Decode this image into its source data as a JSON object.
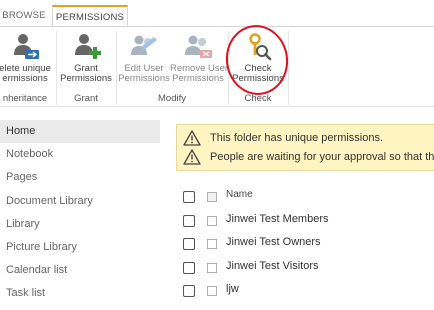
{
  "ribbon": {
    "tabs": [
      {
        "label": "BROWSE"
      },
      {
        "label": "PERMISSIONS"
      }
    ],
    "buttons": {
      "delete_unique": {
        "line1": "elete unique",
        "line2": "ermissions",
        "icon": "users-delete-icon"
      },
      "grant": {
        "line1": "Grant",
        "line2": "Permissions",
        "icon": "user-add-icon"
      },
      "edit_user": {
        "line1": "Edit User",
        "line2": "Permissions",
        "icon": "users-edit-icon"
      },
      "remove_user": {
        "line1": "Remove User",
        "line2": "Permissions",
        "icon": "users-remove-icon"
      },
      "check": {
        "line1": "Check",
        "line2": "Permissions",
        "icon": "key-search-icon"
      }
    },
    "groups": {
      "inheritance": "nheritance",
      "grant": "Grant",
      "modify": "Modify",
      "check": "Check"
    }
  },
  "nav": {
    "items": [
      {
        "label": "Home"
      },
      {
        "label": "Notebook"
      },
      {
        "label": "Pages"
      },
      {
        "label": "Document Library"
      },
      {
        "label": "Library"
      },
      {
        "label": "Picture Library"
      },
      {
        "label": "Calendar list"
      },
      {
        "label": "Task list"
      }
    ]
  },
  "warnings": [
    {
      "text": "This folder has unique permissions."
    },
    {
      "text": "People are waiting for your approval so that th"
    }
  ],
  "list": {
    "header": "Name",
    "rows": [
      {
        "name": "Jinwei Test Members"
      },
      {
        "name": "Jinwei Test Owners"
      },
      {
        "name": "Jinwei Test Visitors"
      },
      {
        "name": "ljw"
      }
    ]
  },
  "colors": {
    "accent": "#e3a21a",
    "warning_bg": "#fff5c2",
    "annotation_circle": "#e01020",
    "icon_blue": "#2a72b8",
    "icon_green": "#3a9a3a"
  }
}
